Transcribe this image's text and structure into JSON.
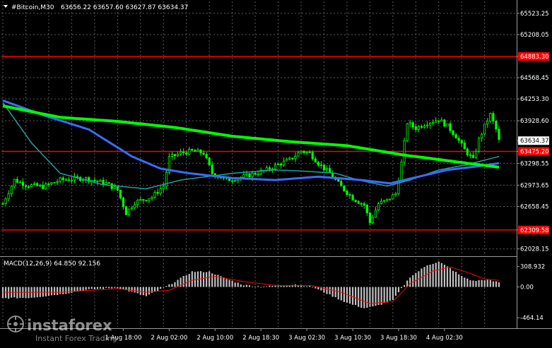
{
  "header": {
    "symbol": "#Bitcoin,M30",
    "ohlc": "63656.22 63657.60 63627.87 63634.37"
  },
  "indicator": {
    "label": "MACD(12,26,9) 64.850 92.156"
  },
  "watermark": {
    "brand": "instaforex",
    "tagline": "Instant Forex Trading"
  },
  "colors": {
    "background": "#000000",
    "grid": "#5a5a5a",
    "candle": "#00ff00",
    "ma_fast": "#20a0a0",
    "ma_mid": "#3a6cff",
    "ma_slow": "#00ff00",
    "level_line": "#ff0000",
    "price_tag": "#ffffff",
    "macd_hist": "#c0c0c0",
    "macd_signal": "#ff0000",
    "text": "#ffffff"
  },
  "chart_data": {
    "type": "candlestick",
    "price_axis_ticks": [
      65523.25,
      65208.05,
      64883.3,
      64568.45,
      64253.3,
      63928.6,
      63634.37,
      63475.2,
      63298.55,
      62973.65,
      62658.45,
      62309.58,
      62028.15
    ],
    "price_axis_labels": [
      "65523.25",
      "65208.05",
      "64883.30",
      "64568.45",
      "64253.30",
      "63928.60",
      "63634.37",
      "63475.20",
      "63298.55",
      "62973.65",
      "62658.45",
      "62309.58",
      "62028.15"
    ],
    "ylim": [
      61930,
      65700
    ],
    "time_axis_labels": [
      "1 Aug 18:00",
      "2 Aug 02:00",
      "2 Aug 10:00",
      "2 Aug 18:30",
      "3 Aug 02:30",
      "3 Aug 10:30",
      "3 Aug 18:30",
      "4 Aug 02:30"
    ],
    "time_axis_index": [
      42,
      58,
      74,
      90,
      106,
      122,
      138,
      154
    ],
    "horizontal_levels": [
      {
        "value": 64883.3,
        "label": "64883.30",
        "color": "#ff0000"
      },
      {
        "value": 63475.2,
        "label": "63475.20",
        "color": "#ff0000"
      },
      {
        "value": 62309.58,
        "label": "62309.58",
        "color": "#ff0000"
      }
    ],
    "current_price": {
      "value": 63634.37,
      "label": "63634.37"
    },
    "bar_count": 174,
    "close_keypoints": [
      [
        0,
        62700
      ],
      [
        4,
        63050
      ],
      [
        8,
        62980
      ],
      [
        14,
        62950
      ],
      [
        20,
        63050
      ],
      [
        28,
        63080
      ],
      [
        36,
        63000
      ],
      [
        40,
        62900
      ],
      [
        43,
        62560
      ],
      [
        46,
        62720
      ],
      [
        52,
        62800
      ],
      [
        56,
        62960
      ],
      [
        58,
        63380
      ],
      [
        62,
        63450
      ],
      [
        66,
        63480
      ],
      [
        70,
        63450
      ],
      [
        73,
        63150
      ],
      [
        78,
        63050
      ],
      [
        84,
        63100
      ],
      [
        88,
        63150
      ],
      [
        92,
        63200
      ],
      [
        96,
        63280
      ],
      [
        100,
        63350
      ],
      [
        104,
        63480
      ],
      [
        107,
        63450
      ],
      [
        110,
        63300
      ],
      [
        114,
        63150
      ],
      [
        118,
        62950
      ],
      [
        122,
        62780
      ],
      [
        126,
        62680
      ],
      [
        128,
        62420
      ],
      [
        131,
        62700
      ],
      [
        134,
        62750
      ],
      [
        137,
        62850
      ],
      [
        139,
        63300
      ],
      [
        141,
        63900
      ],
      [
        144,
        63820
      ],
      [
        148,
        63900
      ],
      [
        152,
        63950
      ],
      [
        155,
        63850
      ],
      [
        158,
        63700
      ],
      [
        161,
        63500
      ],
      [
        164,
        63350
      ],
      [
        166,
        63650
      ],
      [
        168,
        63850
      ],
      [
        170,
        64020
      ],
      [
        172,
        63800
      ],
      [
        173,
        63634
      ]
    ],
    "ma_fast_keypoints": [
      [
        0,
        64200
      ],
      [
        10,
        63600
      ],
      [
        20,
        63150
      ],
      [
        35,
        62980
      ],
      [
        50,
        62920
      ],
      [
        62,
        63050
      ],
      [
        80,
        63150
      ],
      [
        95,
        63200
      ],
      [
        106,
        63180
      ],
      [
        116,
        63150
      ],
      [
        124,
        63050
      ],
      [
        134,
        62960
      ],
      [
        142,
        63050
      ],
      [
        152,
        63200
      ],
      [
        162,
        63280
      ],
      [
        173,
        63400
      ]
    ],
    "ma_mid_keypoints": [
      [
        0,
        64230
      ],
      [
        15,
        64000
      ],
      [
        30,
        63800
      ],
      [
        45,
        63400
      ],
      [
        55,
        63220
      ],
      [
        65,
        63150
      ],
      [
        80,
        63080
      ],
      [
        95,
        63050
      ],
      [
        110,
        63100
      ],
      [
        125,
        63050
      ],
      [
        135,
        63000
      ],
      [
        145,
        63100
      ],
      [
        155,
        63200
      ],
      [
        165,
        63250
      ],
      [
        173,
        63300
      ]
    ],
    "ma_slow_keypoints": [
      [
        0,
        64150
      ],
      [
        20,
        63980
      ],
      [
        40,
        63920
      ],
      [
        60,
        63830
      ],
      [
        80,
        63700
      ],
      [
        100,
        63620
      ],
      [
        120,
        63560
      ],
      [
        140,
        63420
      ],
      [
        160,
        63310
      ],
      [
        173,
        63240
      ]
    ],
    "macd": {
      "ylim": [
        -600,
        420
      ],
      "ticks": [
        308.932,
        0.0,
        -464.14
      ],
      "tick_labels": [
        "308.932",
        "0.00",
        "-464.14"
      ],
      "hist_keypoints": [
        [
          0,
          -170
        ],
        [
          10,
          -160
        ],
        [
          20,
          -110
        ],
        [
          30,
          -40
        ],
        [
          40,
          -10
        ],
        [
          50,
          -140
        ],
        [
          58,
          30
        ],
        [
          66,
          230
        ],
        [
          72,
          230
        ],
        [
          78,
          120
        ],
        [
          84,
          30
        ],
        [
          90,
          5
        ],
        [
          96,
          20
        ],
        [
          102,
          40
        ],
        [
          108,
          0
        ],
        [
          114,
          -120
        ],
        [
          120,
          -240
        ],
        [
          126,
          -320
        ],
        [
          130,
          -290
        ],
        [
          136,
          -200
        ],
        [
          142,
          150
        ],
        [
          148,
          330
        ],
        [
          152,
          380
        ],
        [
          156,
          280
        ],
        [
          160,
          160
        ],
        [
          164,
          90
        ],
        [
          168,
          110
        ],
        [
          173,
          70
        ]
      ],
      "signal_keypoints": [
        [
          0,
          -80
        ],
        [
          20,
          -80
        ],
        [
          40,
          -25
        ],
        [
          50,
          -80
        ],
        [
          58,
          -50
        ],
        [
          66,
          100
        ],
        [
          74,
          160
        ],
        [
          84,
          80
        ],
        [
          96,
          20
        ],
        [
          108,
          20
        ],
        [
          118,
          -80
        ],
        [
          128,
          -250
        ],
        [
          136,
          -220
        ],
        [
          142,
          50
        ],
        [
          150,
          240
        ],
        [
          156,
          300
        ],
        [
          162,
          220
        ],
        [
          168,
          120
        ],
        [
          173,
          100
        ]
      ]
    }
  }
}
